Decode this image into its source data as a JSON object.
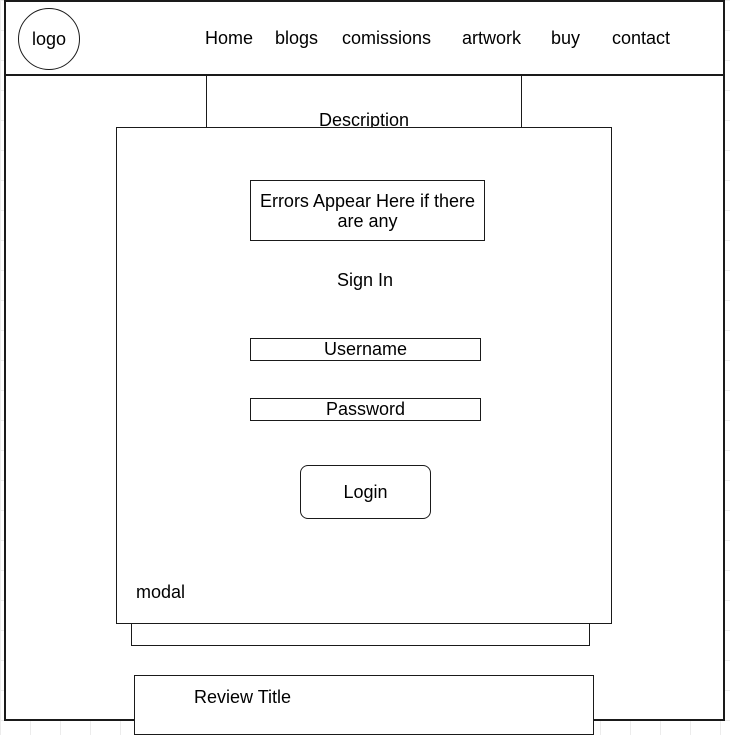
{
  "header": {
    "logo_label": "logo",
    "nav": [
      "Home",
      "blogs",
      "comissions",
      "artwork",
      "buy",
      "contact"
    ]
  },
  "description": {
    "label": "Description"
  },
  "modal": {
    "errors_text": "Errors Appear Here if there are any",
    "title": "Sign In",
    "username_placeholder": "Username",
    "password_placeholder": "Password",
    "login_label": "Login",
    "caption": "modal"
  },
  "review": {
    "title": "Review Title"
  }
}
